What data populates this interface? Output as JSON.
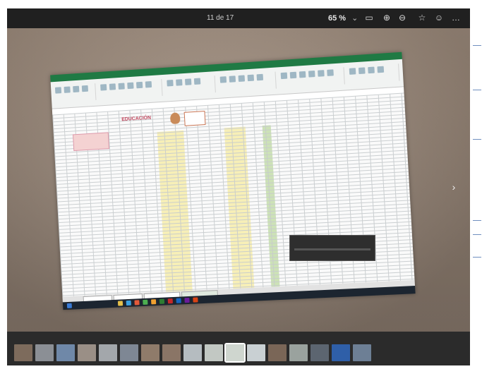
{
  "viewer": {
    "page_counter": "11 de 17",
    "zoom_level": "65 %",
    "zoom_caret": "⌄",
    "toolbar_icons": [
      "fit-page-icon",
      "zoom-in-icon",
      "zoom-out-icon",
      "favorite-icon",
      "emoji-icon",
      "more-icon"
    ],
    "toolbar_glyphs": [
      "▭",
      "⊕",
      "⊖",
      "☆",
      "☺",
      "…"
    ],
    "next_arrow": "›"
  },
  "photo": {
    "description_tag": "photo-of-projected-spreadsheet",
    "sheet_logo_text": "EDUCACIÓN",
    "thumbnail_count": 17,
    "active_thumbnail": 11
  }
}
